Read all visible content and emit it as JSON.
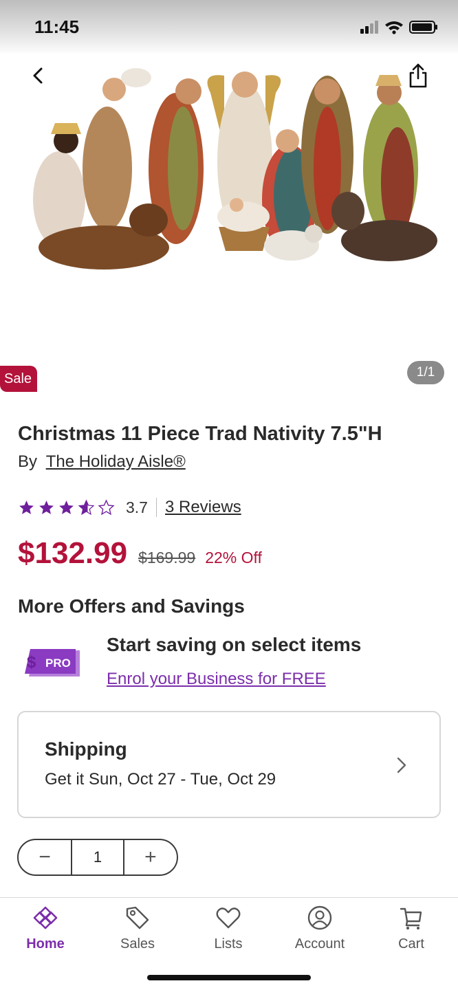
{
  "status_bar": {
    "time": "11:45"
  },
  "product": {
    "sale_badge": "Sale",
    "image_counter": "1/1",
    "title": "Christmas 11 Piece Trad Nativity 7.5\"H",
    "by_label": "By",
    "brand": "The Holiday Aisle®",
    "rating": "3.7",
    "rating_value": 3.7,
    "reviews_label": "3 Reviews",
    "price": "$132.99",
    "original_price": "$169.99",
    "discount": "22% Off"
  },
  "offers": {
    "heading": "More Offers and Savings",
    "pro_logo_text": "PRO",
    "title": "Start saving on select items",
    "link": "Enrol your Business for FREE"
  },
  "shipping": {
    "title": "Shipping",
    "date_range": "Get it Sun, Oct 27 - Tue, Oct 29"
  },
  "quantity": {
    "minus": "−",
    "value": "1",
    "plus": "+"
  },
  "tab_bar": {
    "tabs": [
      {
        "label": "Home",
        "icon": "home-icon",
        "active": true
      },
      {
        "label": "Sales",
        "icon": "tag-icon",
        "active": false
      },
      {
        "label": "Lists",
        "icon": "heart-icon",
        "active": false
      },
      {
        "label": "Account",
        "icon": "account-icon",
        "active": false
      },
      {
        "label": "Cart",
        "icon": "cart-icon",
        "active": false
      }
    ]
  },
  "colors": {
    "sale_red": "#b3123a",
    "brand_purple": "#7b2eab",
    "star_purple": "#6f1f9c"
  }
}
